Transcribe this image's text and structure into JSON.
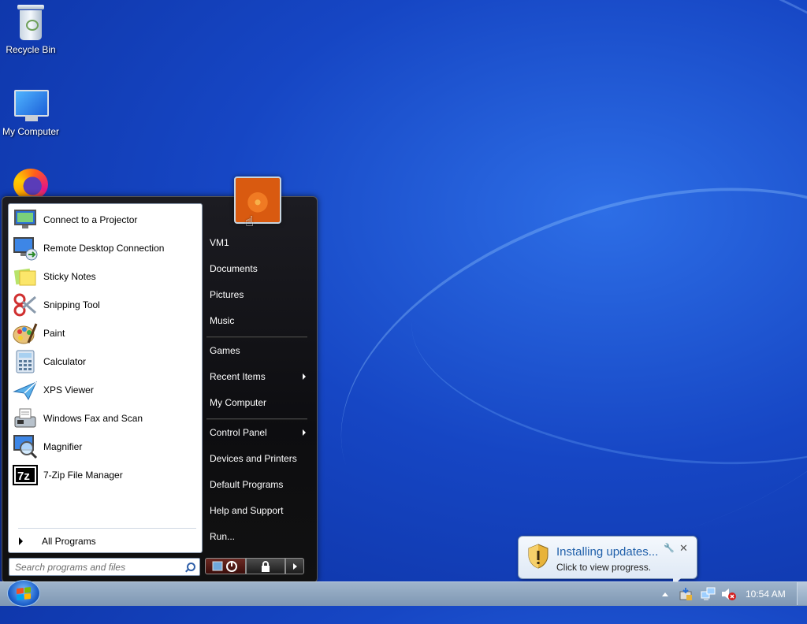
{
  "desktop": {
    "icons": [
      {
        "label": "Recycle Bin",
        "icon": "recycle-bin-icon"
      },
      {
        "label": "My Computer",
        "icon": "computer-icon"
      },
      {
        "label": "",
        "icon": "firefox-icon"
      }
    ]
  },
  "start_menu": {
    "programs": [
      {
        "label": "Connect to a Projector",
        "icon": "projector-icon"
      },
      {
        "label": "Remote Desktop Connection",
        "icon": "remote-desktop-icon"
      },
      {
        "label": "Sticky Notes",
        "icon": "sticky-notes-icon"
      },
      {
        "label": "Snipping Tool",
        "icon": "scissors-icon"
      },
      {
        "label": "Paint",
        "icon": "paint-palette-icon"
      },
      {
        "label": "Calculator",
        "icon": "calculator-icon"
      },
      {
        "label": "XPS Viewer",
        "icon": "xps-viewer-icon"
      },
      {
        "label": "Windows Fax and Scan",
        "icon": "fax-icon"
      },
      {
        "label": "Magnifier",
        "icon": "magnifier-icon"
      },
      {
        "label": "7-Zip File Manager",
        "icon": "seven-zip-icon"
      }
    ],
    "all_programs": "All Programs",
    "search_placeholder": "Search programs and files",
    "right_items": [
      {
        "label": "VM1",
        "has_submenu": false
      },
      {
        "label": "Documents",
        "has_submenu": false
      },
      {
        "label": "Pictures",
        "has_submenu": false
      },
      {
        "label": "Music",
        "has_submenu": false
      },
      {
        "label": "Games",
        "has_submenu": false
      },
      {
        "label": "Recent Items",
        "has_submenu": true
      },
      {
        "label": "My Computer",
        "has_submenu": false
      },
      {
        "label": "Control Panel",
        "has_submenu": true
      },
      {
        "label": "Devices and Printers",
        "has_submenu": false
      },
      {
        "label": "Default Programs",
        "has_submenu": false
      },
      {
        "label": "Help and Support",
        "has_submenu": false
      },
      {
        "label": "Run...",
        "has_submenu": false
      }
    ]
  },
  "notification": {
    "title": "Installing updates...",
    "subtitle": "Click to view progress."
  },
  "taskbar": {
    "clock": "10:54 AM"
  },
  "colors": {
    "accent": "#1646c4",
    "balloon_title": "#1f5faa"
  }
}
